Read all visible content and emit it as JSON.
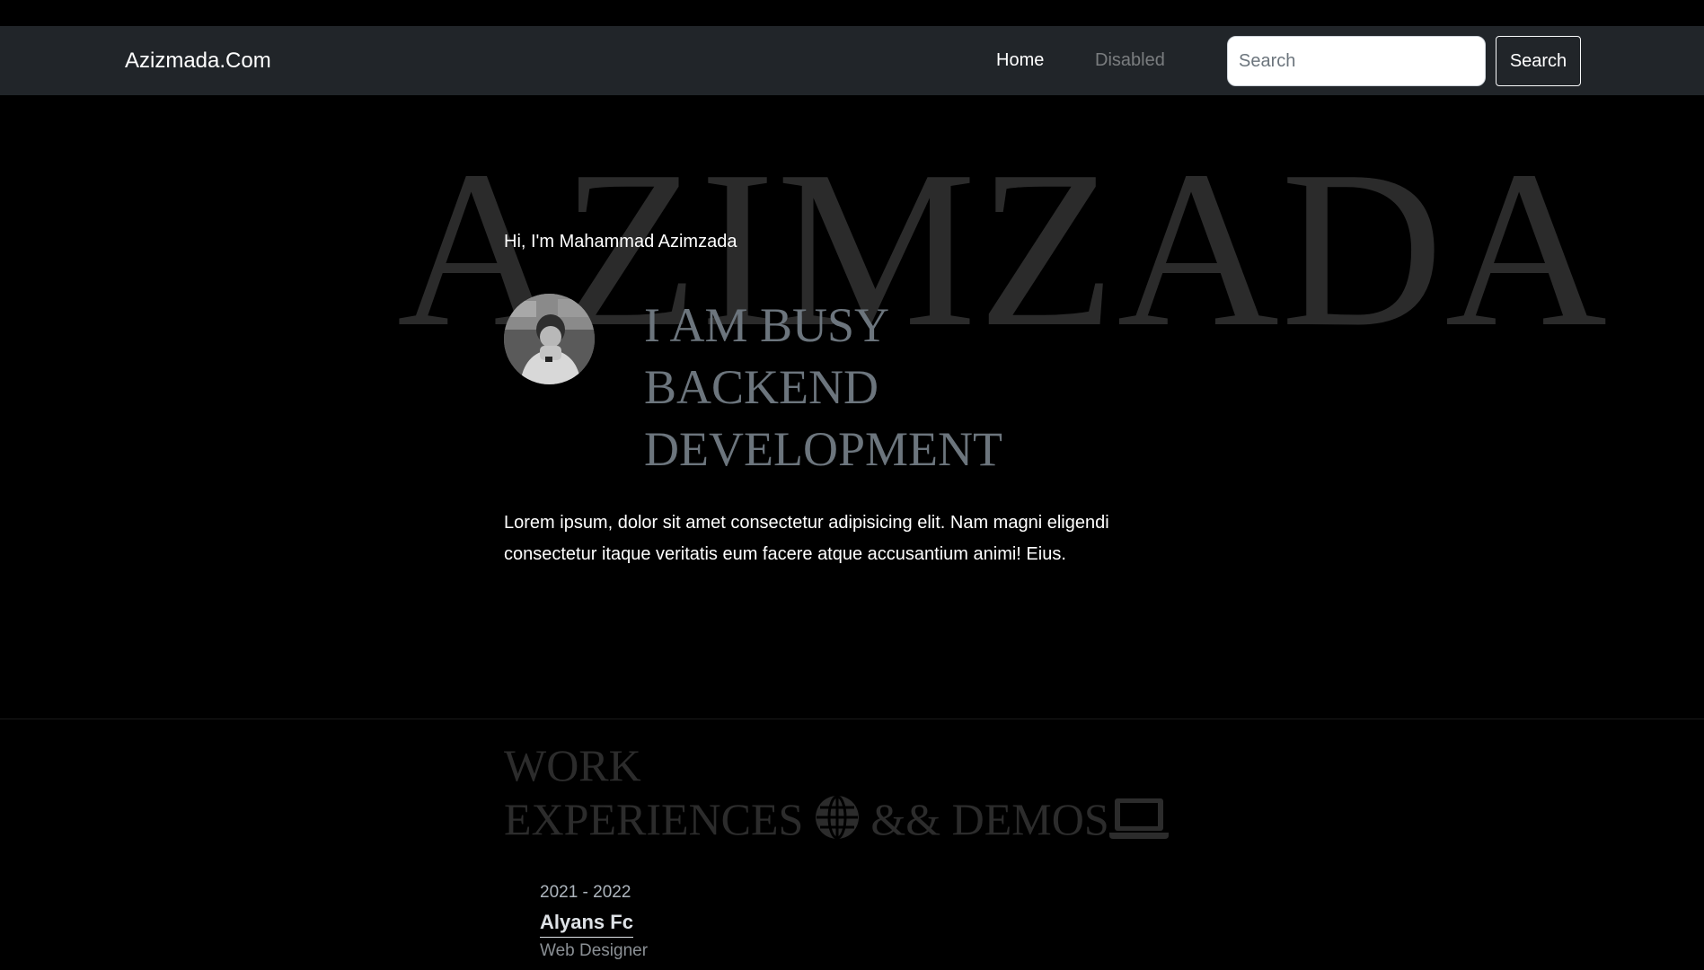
{
  "navbar": {
    "brand": "Azizmada.Com",
    "links": [
      {
        "label": "Home",
        "state": "active"
      },
      {
        "label": "Disabled",
        "state": "disabled"
      }
    ],
    "search": {
      "placeholder": "Search",
      "value": "",
      "button_label": "Search"
    }
  },
  "hero": {
    "background_word": "AZIMZADA",
    "greeting": "Hi, I'm Mahammad Azimzada",
    "headline_lines": [
      "I AM BUSY",
      "BACKEND",
      "DEVELOPMENT"
    ],
    "description": "Lorem ipsum, dolor sit amet consectetur adipisicing elit. Nam magni eligendi consectetur itaque veritatis eum facere atque accusantium animi! Eius."
  },
  "work": {
    "title_line1": "WORK",
    "title_line2_a": "EXPERIENCES",
    "title_line2_b": "&& DEMOS",
    "icons": [
      "globe-icon",
      "laptop-icon"
    ],
    "items": [
      {
        "date": "2021 - 2022",
        "company": "Alyans Fc",
        "role": "Web Designer"
      }
    ]
  },
  "colors": {
    "navbar_bg": "#212529",
    "page_bg": "#000000",
    "headline": "#6c757d",
    "background_word": "#2b2b2b",
    "section_title": "#2c2c2c"
  }
}
